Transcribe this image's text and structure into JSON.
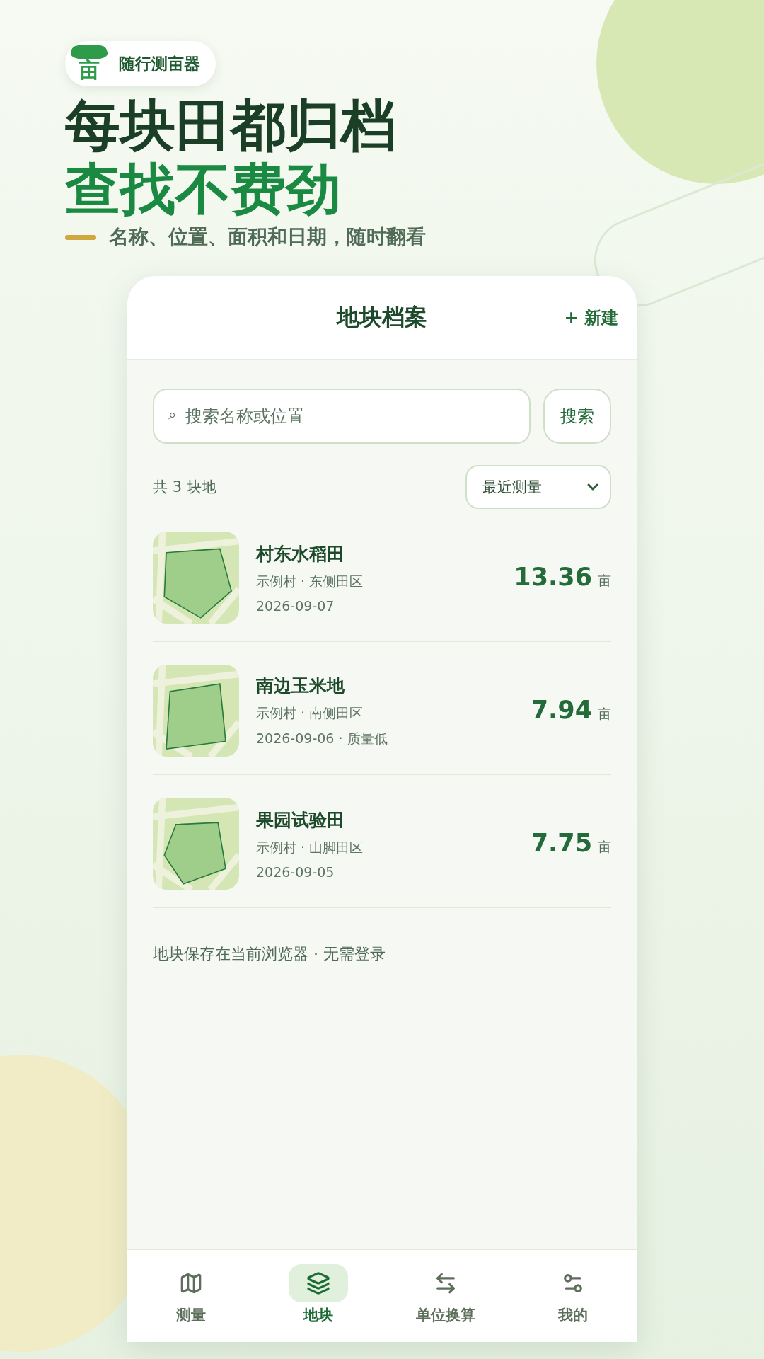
{
  "app_badge": {
    "logo_glyph": "亩",
    "name": "随行测亩器"
  },
  "headline": {
    "line_1": "每块田都归档",
    "line_2": "查找不费劲",
    "subtitle": "名称、位置、面积和日期，随时翻看"
  },
  "screen": {
    "title": "地块档案",
    "new_button": "+ 新建",
    "search": {
      "placeholder": "搜索名称或位置",
      "search_icon": "⌕",
      "button": "搜索"
    },
    "count": "共 3 块地",
    "sort": "最近测量",
    "plots": [
      {
        "name": "村东水稻田",
        "location": "示例村 · 东侧田区",
        "date": "2026-09-07",
        "area": "13.36",
        "unit": "亩"
      },
      {
        "name": "南边玉米地",
        "location": "示例村 · 南侧田区",
        "date": "2026-09-06 · 质量低",
        "area": "7.94",
        "unit": "亩"
      },
      {
        "name": "果园试验田",
        "location": "示例村 · 山脚田区",
        "date": "2026-09-05",
        "area": "7.75",
        "unit": "亩"
      }
    ],
    "footer_note": "地块保存在当前浏览器 · 无需登录",
    "nav": [
      {
        "kind": "map",
        "label": "测量",
        "selected": false
      },
      {
        "kind": "layers",
        "label": "地块",
        "selected": true
      },
      {
        "kind": "convert",
        "label": "单位换算",
        "selected": false
      },
      {
        "kind": "settings",
        "label": "我的",
        "selected": false
      }
    ]
  }
}
